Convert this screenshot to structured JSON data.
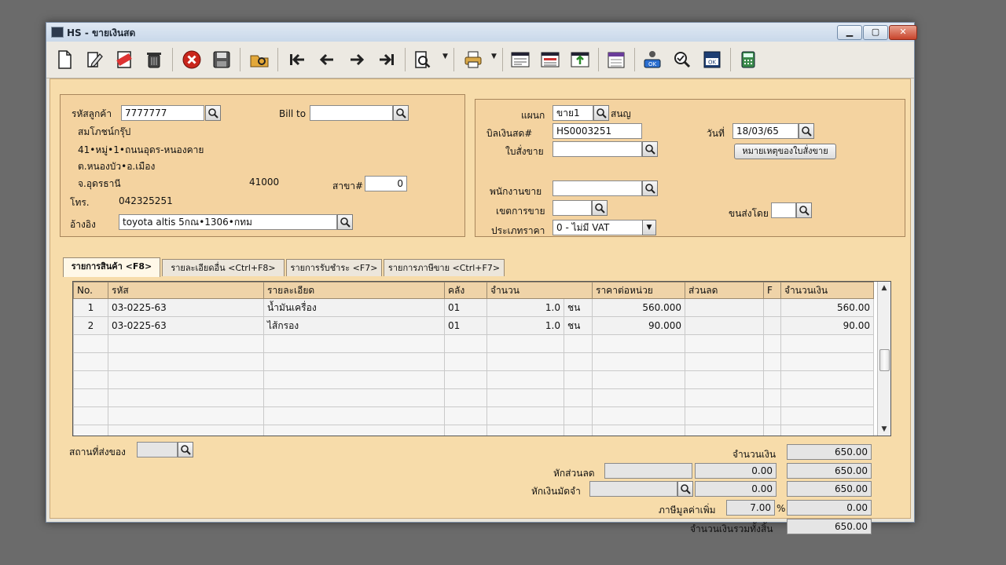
{
  "window": {
    "title": "HS - ขายเงินสด",
    "minimize": "▁",
    "maximize": "▢",
    "close": "✕"
  },
  "customer": {
    "code_label": "รหัสลูกค้า",
    "code_value": "7777777",
    "name": "สมโภชน์กรุ๊ป",
    "address1": "41•หมู่•1•ถนนอุดร-หนองคาย",
    "address2": "ต.หนองบัว•อ.เมือง",
    "province": "จ.อุดรธานี",
    "postcode": "41000",
    "phone_label": "โทร.",
    "phone": "042325251",
    "ref_label": "อ้างอิง",
    "ref_value": "toyota altis 5กณ•1306•กทม",
    "bill_to_label": "Bill to",
    "bill_to_value": "",
    "branch_label": "สาขา#",
    "branch_value": "0"
  },
  "document": {
    "dept_label": "แผนก",
    "dept_value": "ขาย1",
    "dept_name": "สนญ",
    "bill_label": "บิลเงินสด#",
    "bill_value": "HS0003251",
    "date_label": "วันที่",
    "date_value": "18/03/65",
    "order_label": "ใบสั่งขาย",
    "order_value": "",
    "note_button": "หมายเหตุของใบสั่งขาย",
    "sales_label": "พนักงานขาย",
    "sales_value": "",
    "zone_label": "เขตการขาย",
    "zone_value": "",
    "ship_label": "ขนส่งโดย",
    "ship_value": "",
    "price_type_label": "ประเภทราคา",
    "price_type_value": "0 - ไม่มี VAT"
  },
  "tabs": [
    {
      "label": "รายการสินค้า <F8>"
    },
    {
      "label": "รายละเอียดอื่น <Ctrl+F8>"
    },
    {
      "label": "รายการรับชำระ <F7>"
    },
    {
      "label": "รายการภาษีขาย <Ctrl+F7>"
    }
  ],
  "grid": {
    "headers": {
      "no": "No.",
      "code": "รหัส",
      "desc": "รายละเอียด",
      "wh": "คลัง",
      "qty": "จำนวน",
      "price": "ราคาต่อหน่วย",
      "disc": "ส่วนลด",
      "f": "F",
      "amount": "จำนวนเงิน"
    },
    "rows": [
      {
        "no": "1",
        "code": "03-0225-63",
        "desc": "น้ำมันเครื่อง",
        "wh": "01",
        "qty": "1.0",
        "unit": "ชน",
        "price": "560.000",
        "disc": "",
        "f": "",
        "amount": "560.00"
      },
      {
        "no": "2",
        "code": "03-0225-63",
        "desc": "ไส้กรอง",
        "wh": "01",
        "qty": "1.0",
        "unit": "ชน",
        "price": "90.000",
        "disc": "",
        "f": "",
        "amount": "90.00"
      }
    ]
  },
  "footer": {
    "ship_place_label": "สถานที่ส่งของ",
    "ship_place_value": "",
    "total_label": "จำนวนเงิน",
    "total_value": "650.00",
    "discount_label": "หักส่วนลด",
    "discount_input": "",
    "discount_amount": "0.00",
    "after_discount": "650.00",
    "deposit_label": "หักเงินมัดจำ",
    "deposit_input": "",
    "deposit_amount": "0.00",
    "after_deposit": "650.00",
    "vat_label": "ภาษีมูลค่าเพิ่ม",
    "vat_rate": "7.00",
    "vat_percent": "%",
    "vat_amount": "0.00",
    "grand_label": "จำนวนเงินรวมทั้งสิ้น",
    "grand_value": "650.00"
  }
}
